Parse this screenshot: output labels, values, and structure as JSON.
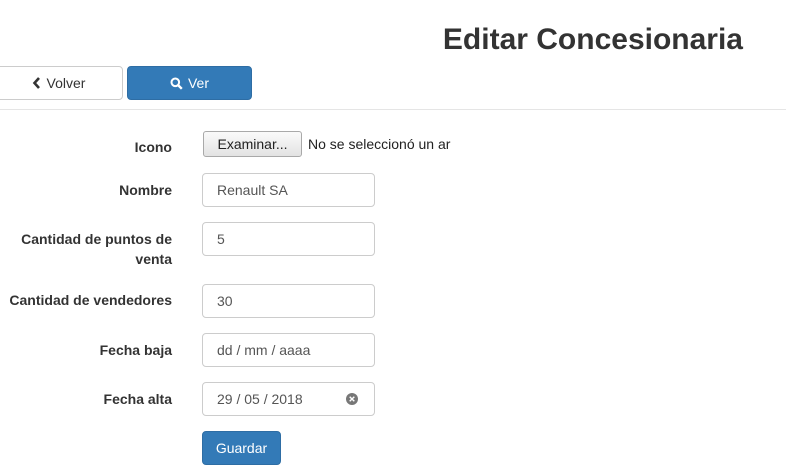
{
  "page": {
    "title": "Editar Concesionaria"
  },
  "toolbar": {
    "back_label": "Volver",
    "back_icon": "chevron-left-icon",
    "view_label": "Ver",
    "view_icon": "search-icon"
  },
  "form": {
    "icono": {
      "label": "Icono",
      "button_label": "Examinar...",
      "status": "No se seleccionó un ar"
    },
    "nombre": {
      "label": "Nombre",
      "value": "Renault SA"
    },
    "puntos_venta": {
      "label": "Cantidad de puntos de venta",
      "value": "5"
    },
    "vendedores": {
      "label": "Cantidad de vendedores",
      "value": "30"
    },
    "fecha_baja": {
      "label": "Fecha baja",
      "placeholder": "dd / mm / aaaa"
    },
    "fecha_alta": {
      "label": "Fecha alta",
      "value": "29 / 05 / 2018"
    },
    "save_label": "Guardar"
  },
  "colors": {
    "primary": "#337ab7",
    "text": "#333333",
    "border": "#cccccc"
  }
}
